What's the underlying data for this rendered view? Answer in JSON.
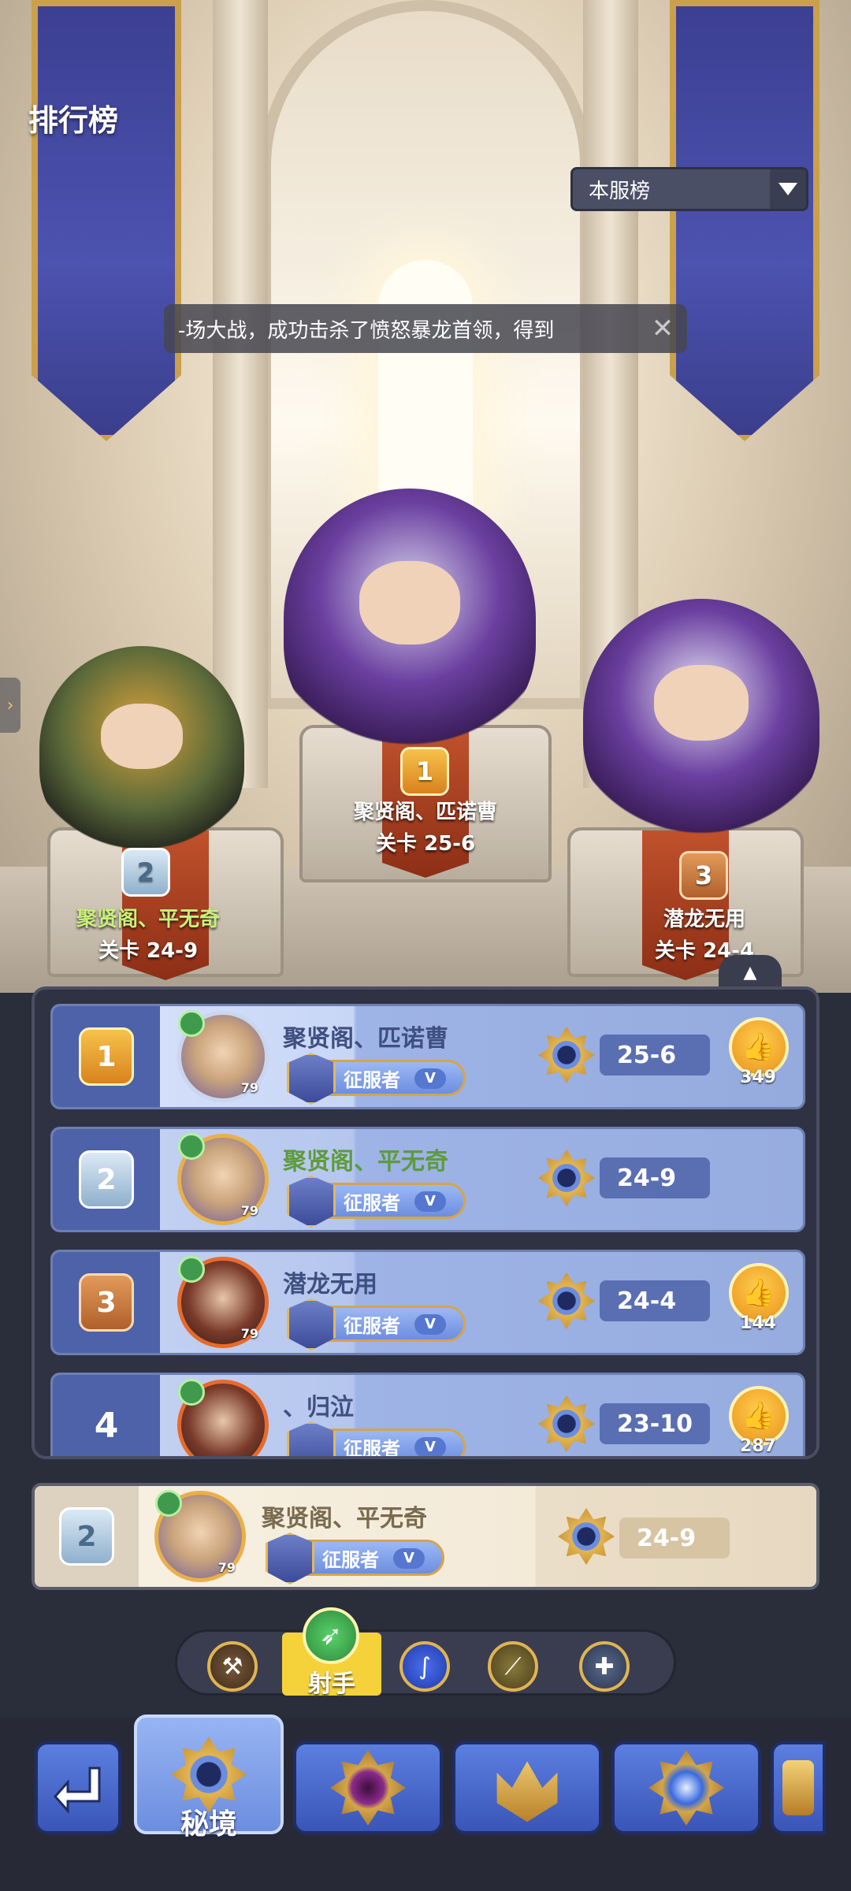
{
  "header": {
    "title": "排行榜",
    "server_select": "本服榜"
  },
  "ticker": {
    "text": "-场大战，成功击杀了愤怒暴龙首领，得到"
  },
  "podium": [
    {
      "rank": "1",
      "name": "聚贤阁、匹诺曹",
      "stage": "关卡 25-6"
    },
    {
      "rank": "2",
      "name": "聚贤阁、平无奇",
      "stage": "关卡 24-9"
    },
    {
      "rank": "3",
      "name": "潜龙无用",
      "stage": "关卡 24-4"
    }
  ],
  "leaderboard": {
    "rows": [
      {
        "rank": "1",
        "name": "聚贤阁、匹诺曹",
        "level": "79",
        "title": "征服者",
        "title_tier": "V",
        "stage": "25-6",
        "likes": "349"
      },
      {
        "rank": "2",
        "name": "聚贤阁、平无奇",
        "level": "79",
        "title": "征服者",
        "title_tier": "V",
        "stage": "24-9",
        "likes": ""
      },
      {
        "rank": "3",
        "name": "潜龙无用",
        "level": "79",
        "title": "征服者",
        "title_tier": "V",
        "stage": "24-4",
        "likes": "144"
      },
      {
        "rank": "4",
        "name": "、归泣",
        "level": "",
        "title": "征服者",
        "title_tier": "V",
        "stage": "23-10",
        "likes": "287"
      }
    ]
  },
  "my_rank": {
    "rank": "2",
    "name": "聚贤阁、平无奇",
    "level": "79",
    "title": "征服者",
    "title_tier": "V",
    "stage": "24-9"
  },
  "class_tabs": {
    "active_label": "射手"
  },
  "bottom_nav": {
    "active_label": "秘境"
  },
  "colors": {
    "accent_gold": "#e0b452",
    "panel_bg": "#2f3242",
    "row_blue": "#b5c6ee",
    "name_green": "#5e9b3c"
  }
}
